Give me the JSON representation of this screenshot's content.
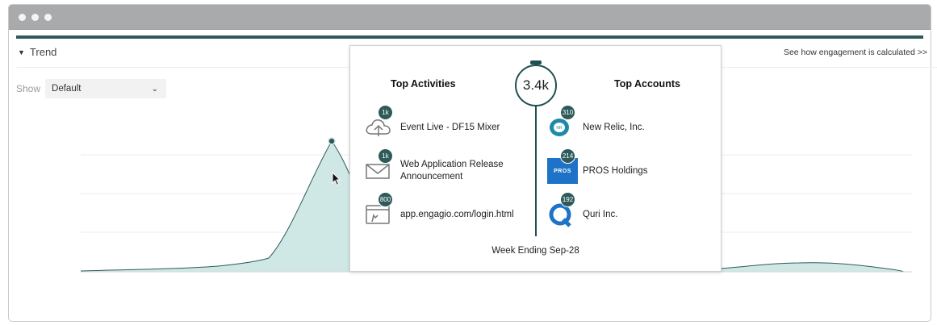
{
  "trend": {
    "title": "Trend",
    "engagement_link": "See how engagement is calculated >>"
  },
  "filter": {
    "show_label": "Show",
    "selected": "Default"
  },
  "popup": {
    "total": "3.4k",
    "activities_title": "Top Activities",
    "accounts_title": "Top Accounts",
    "week_label": "Week Ending Sep-28",
    "activities": [
      {
        "badge": "1k",
        "label": "Event Live - DF15 Mixer",
        "icon": "cloud-upload-icon"
      },
      {
        "badge": "1k",
        "label": "Web Application Release Announcement",
        "icon": "email-icon"
      },
      {
        "badge": "800",
        "label": "app.engagio.com/login.html",
        "icon": "web-page-visit-icon"
      }
    ],
    "accounts": [
      {
        "badge": "310",
        "label": "New Relic, Inc.",
        "icon": "new-relic-logo"
      },
      {
        "badge": "214",
        "label": "PROS Holdings",
        "icon": "pros-logo",
        "logo_text": "PROS"
      },
      {
        "badge": "192",
        "label": "Quri Inc.",
        "icon": "quri-logo"
      }
    ]
  },
  "colors": {
    "accent": "#2f5a5a",
    "area_fill": "#cfe8e5",
    "area_stroke": "#2f5a5a",
    "titlebar": "#a9aaab"
  }
}
